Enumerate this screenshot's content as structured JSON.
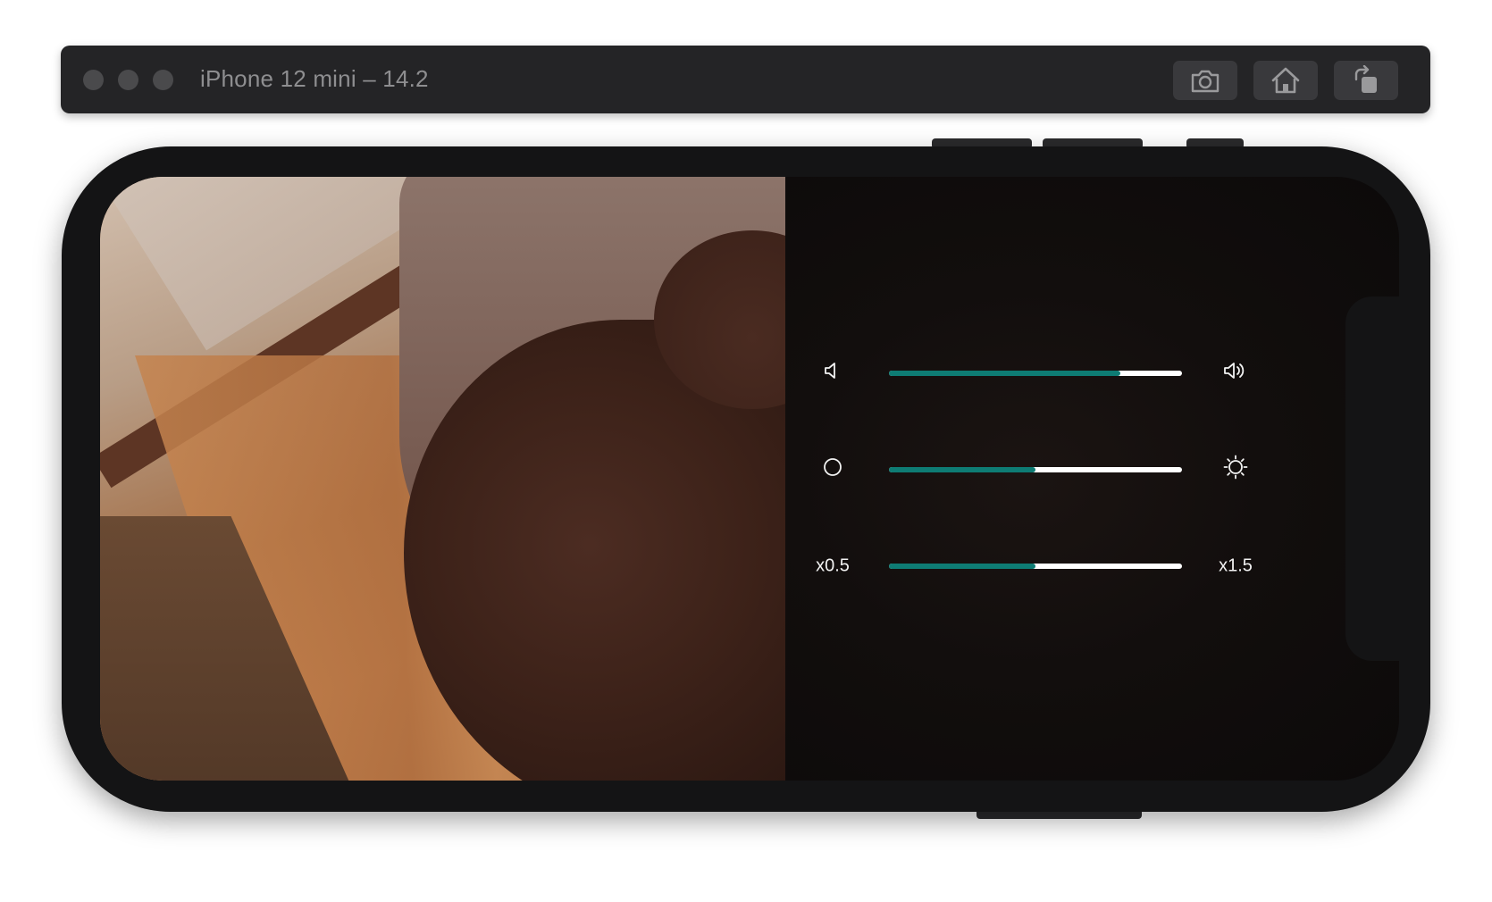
{
  "simulator": {
    "title": "iPhone 12 mini – 14.2",
    "toolbar": [
      {
        "name": "screenshot",
        "icon": "camera-icon"
      },
      {
        "name": "home",
        "icon": "home-icon"
      },
      {
        "name": "rotate",
        "icon": "rotate-icon"
      }
    ]
  },
  "player": {
    "controls": [
      {
        "name": "volume",
        "min_icon": "speaker-low-icon",
        "max_icon": "speaker-high-icon",
        "value": 0.79
      },
      {
        "name": "brightness",
        "min_icon": "circle-icon",
        "max_icon": "sun-icon",
        "value": 0.5
      },
      {
        "name": "speed",
        "min_label": "x0.5",
        "max_label": "x1.5",
        "value": 0.5
      }
    ]
  },
  "colors": {
    "accent": "#0e7c74",
    "track": "#ffffff",
    "titlebar": "#242426",
    "device": "#141415"
  }
}
